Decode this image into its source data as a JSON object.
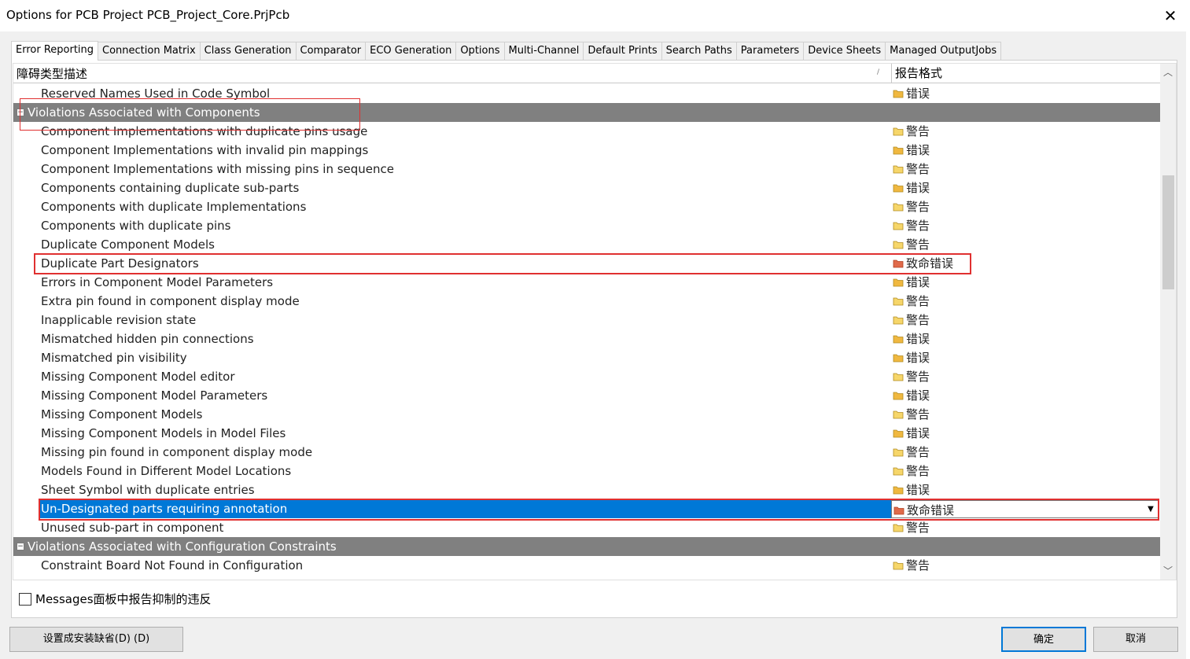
{
  "window": {
    "title": "Options for PCB Project PCB_Project_Core.PrjPcb",
    "close_symbol": "✕"
  },
  "tabs": [
    {
      "label": "Error Reporting",
      "active": true
    },
    {
      "label": "Connection Matrix"
    },
    {
      "label": "Class Generation"
    },
    {
      "label": "Comparator"
    },
    {
      "label": "ECO Generation"
    },
    {
      "label": "Options"
    },
    {
      "label": "Multi-Channel"
    },
    {
      "label": "Default Prints"
    },
    {
      "label": "Search Paths"
    },
    {
      "label": "Parameters"
    },
    {
      "label": "Device Sheets"
    },
    {
      "label": "Managed OutputJobs"
    }
  ],
  "grid": {
    "col_description": "障碍类型描述",
    "col_report_mode": "报告格式",
    "sort_indicator": "/",
    "expander_symbol": "⊟",
    "dropdown_arrow": "▼",
    "rows": [
      {
        "label": "Reserved Names Used in Code Symbol",
        "value": "错误",
        "level": "error"
      },
      {
        "label": "Violations Associated with Components",
        "group": true
      },
      {
        "label": "Component Implementations with duplicate pins usage",
        "value": "警告",
        "level": "warning"
      },
      {
        "label": "Component Implementations with invalid pin mappings",
        "value": "错误",
        "level": "error"
      },
      {
        "label": "Component Implementations with missing pins in sequence",
        "value": "警告",
        "level": "warning"
      },
      {
        "label": "Components containing duplicate sub-parts",
        "value": "错误",
        "level": "error"
      },
      {
        "label": "Components with duplicate Implementations",
        "value": "警告",
        "level": "warning"
      },
      {
        "label": "Components with duplicate pins",
        "value": "警告",
        "level": "warning"
      },
      {
        "label": "Duplicate Component Models",
        "value": "警告",
        "level": "warning"
      },
      {
        "label": "Duplicate Part Designators",
        "value": "致命错误",
        "level": "fatal"
      },
      {
        "label": "Errors in Component Model Parameters",
        "value": "错误",
        "level": "error"
      },
      {
        "label": "Extra pin found in component display mode",
        "value": "警告",
        "level": "warning"
      },
      {
        "label": "Inapplicable revision state",
        "value": "警告",
        "level": "warning"
      },
      {
        "label": "Mismatched hidden pin connections",
        "value": "错误",
        "level": "error"
      },
      {
        "label": "Mismatched pin visibility",
        "value": "错误",
        "level": "error"
      },
      {
        "label": "Missing Component Model editor",
        "value": "警告",
        "level": "warning"
      },
      {
        "label": "Missing Component Model Parameters",
        "value": "错误",
        "level": "error"
      },
      {
        "label": "Missing Component Models",
        "value": "警告",
        "level": "warning"
      },
      {
        "label": "Missing Component Models in Model Files",
        "value": "错误",
        "level": "error"
      },
      {
        "label": "Missing pin found in component display mode",
        "value": "警告",
        "level": "warning"
      },
      {
        "label": "Models Found in Different Model Locations",
        "value": "警告",
        "level": "warning"
      },
      {
        "label": "Sheet Symbol with duplicate entries",
        "value": "错误",
        "level": "error"
      },
      {
        "label": "Un-Designated parts requiring annotation",
        "value": "致命错误",
        "level": "fatal",
        "selected": true
      },
      {
        "label": "Unused sub-part in component",
        "value": "警告",
        "level": "warning"
      },
      {
        "label": "Violations Associated with Configuration Constraints",
        "group": true
      },
      {
        "label": "Constraint Board Not Found in Configuration",
        "value": "警告",
        "level": "warning"
      }
    ]
  },
  "colors": {
    "warning_folder": "#f6d66a",
    "error_folder": "#f0b840",
    "fatal_folder": "#e06a4a",
    "selection": "#0078d7",
    "group_bg": "#808080",
    "annotation_red": "#e03030"
  },
  "suppress_checkbox": {
    "label": "Messages面板中报告抑制的违反",
    "checked": false
  },
  "buttons": {
    "set_defaults": "设置成安装缺省(D) (D)",
    "ok": "确定",
    "cancel": "取消"
  }
}
